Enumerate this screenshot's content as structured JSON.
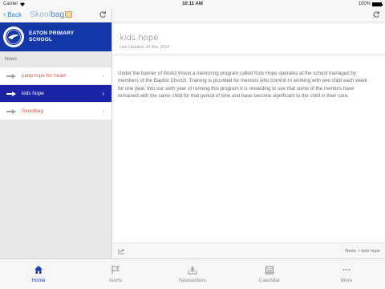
{
  "status": {
    "carrier": "Carrier",
    "time": "10:11 AM",
    "battery": "100%",
    "battery_level": 1.0
  },
  "left_nav": {
    "back_label": "Back",
    "logo_light": "Skool",
    "logo_dark": "bag"
  },
  "school": {
    "name_line1": "EATON PRIMARY",
    "name_line2": "SCHOOL"
  },
  "section": {
    "label": "News"
  },
  "list": [
    {
      "label": "jump rope for heart",
      "active": false
    },
    {
      "label": "kids hope",
      "active": true
    },
    {
      "label": "Skoolbag",
      "active": false
    }
  ],
  "article": {
    "title": "kids hope",
    "updated": "Last Updated: 19 Nov, 2014",
    "body": "Under the banner of World Vision a mentoring program called Kids Hope operates at the school managed by members of the Baptist Church. Training is provided for mentors who commit to working with one child each week for one year. Into our sixth year of running this program it is rewarding to see that some of the mentors have remained with the same child for that period of time and have become significant to the child in their care.",
    "breadcrumb": "News > kids hope"
  },
  "tabs": [
    {
      "label": "Home",
      "icon": "home-icon",
      "active": true
    },
    {
      "label": "Alerts",
      "icon": "flag-icon",
      "active": false
    },
    {
      "label": "Newsletters",
      "icon": "inbox-icon",
      "active": false
    },
    {
      "label": "Calendar",
      "icon": "calendar-icon",
      "active": false
    },
    {
      "label": "More",
      "icon": "more-icon",
      "active": false
    }
  ],
  "colors": {
    "accent": "#1a24a9",
    "link": "#2a8bd6",
    "item_text": "#d9534f"
  }
}
